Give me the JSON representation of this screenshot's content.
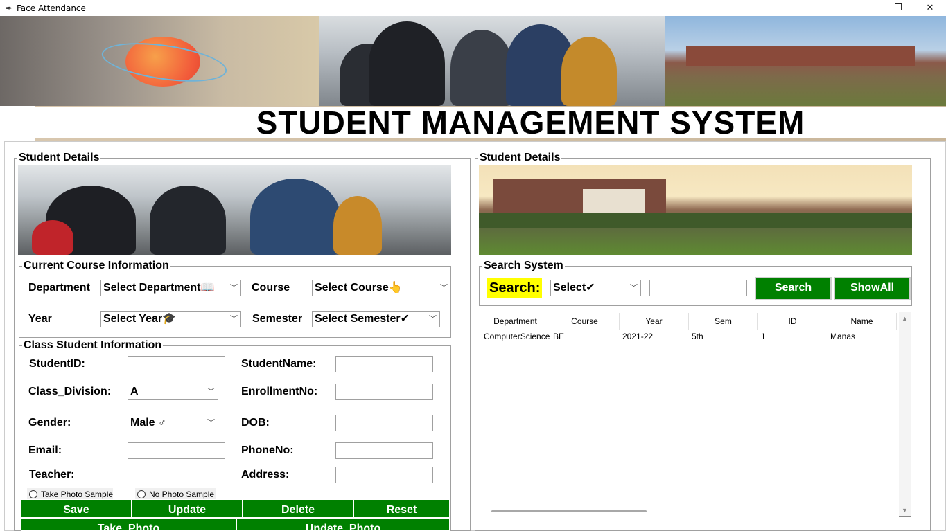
{
  "window": {
    "title": "Face Attendance",
    "minimize_glyph": "—",
    "maximize_glyph": "❐",
    "close_glyph": "✕"
  },
  "header": {
    "title": "STUDENT MANAGEMENT SYSTEM"
  },
  "left_panel": {
    "legend": "Student Details",
    "course_frame": {
      "legend": "Current Course Information",
      "department_label": "Department",
      "department_value": "Select Department📖",
      "course_label": "Course",
      "course_value": "Select Course👆",
      "year_label": "Year",
      "year_value": "Select Year🎓",
      "semester_label": "Semester",
      "semester_value": "Select Semester✔"
    },
    "class_frame": {
      "legend": "Class Student Information",
      "student_id_label": "StudentID:",
      "student_name_label": "StudentName:",
      "class_division_label": "Class_Division:",
      "class_division_value": "A",
      "enrollment_label": "EnrollmentNo:",
      "gender_label": "Gender:",
      "gender_value": "Male ♂",
      "dob_label": "DOB:",
      "email_label": "Email:",
      "phone_label": "PhoneNo:",
      "teacher_label": "Teacher:",
      "address_label": "Address:",
      "radio_take": "Take Photo Sample",
      "radio_no": "No Photo Sample"
    },
    "buttons": {
      "save": "Save",
      "update": "Update",
      "delete": "Delete",
      "reset": "Reset",
      "take_photo": "Take_Photo",
      "update_photo": "Update_Photo"
    }
  },
  "right_panel": {
    "legend": "Student Details",
    "search_frame": {
      "legend": "Search System",
      "search_label": "Search:",
      "select_value": "Select✔",
      "search_button": "Search",
      "showall_button": "ShowAll"
    },
    "table": {
      "columns": [
        "Department",
        "Course",
        "Year",
        "Sem",
        "ID",
        "Name"
      ],
      "rows": [
        [
          "ComputerScience",
          "BE",
          "2021-22",
          "5th",
          "1",
          "Manas"
        ]
      ]
    }
  },
  "icons": {
    "app": "feather-icon",
    "dropdown": "chevron-down-icon"
  }
}
